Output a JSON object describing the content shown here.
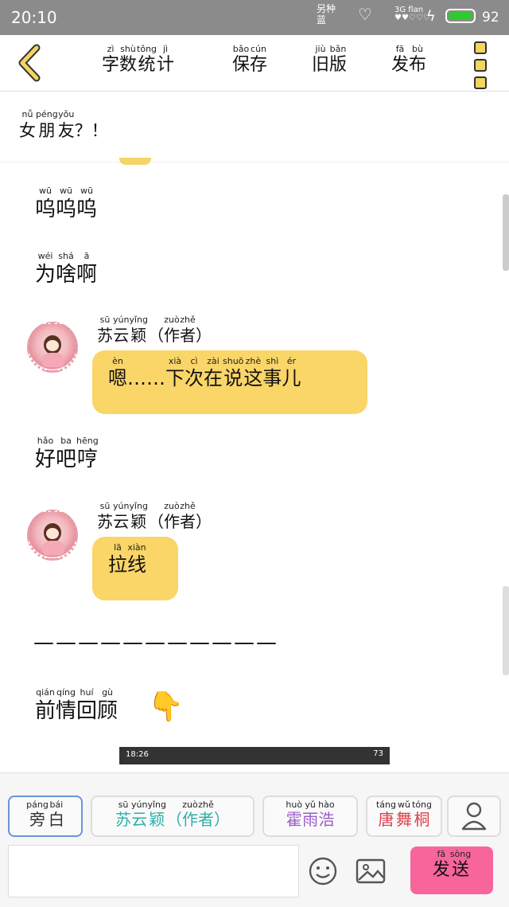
{
  "status_bar": {
    "time": "20:10",
    "carrier_top": "另种",
    "carrier_bottom": "蓝",
    "network": "3G flan",
    "signal": "♥♥♡♡♡",
    "battery_percent": "92",
    "battery_color": "#32c832"
  },
  "toolbar": {
    "items": [
      {
        "pinyin": [
          "zì",
          "shù",
          "tǒng",
          "jì"
        ],
        "hanzi": [
          "字",
          "数",
          "统",
          "计"
        ]
      },
      {
        "pinyin": [
          "bǎo",
          "cún"
        ],
        "hanzi": [
          "保",
          "存"
        ]
      },
      {
        "pinyin": [
          "jiù",
          "bǎn"
        ],
        "hanzi": [
          "旧",
          "版"
        ]
      },
      {
        "pinyin": [
          "fā",
          "bù"
        ],
        "hanzi": [
          "发",
          "布"
        ]
      }
    ]
  },
  "topic": {
    "pinyin": [
      "nǚ",
      "péng",
      "yǒu",
      ""
    ],
    "hanzi": [
      "女",
      "朋",
      "友",
      "？！"
    ]
  },
  "lines": [
    {
      "pinyin": [
        "wū",
        "wū",
        "wū"
      ],
      "hanzi": [
        "呜",
        "呜",
        "呜"
      ]
    },
    {
      "pinyin": [
        "wéi",
        "shá",
        "ā"
      ],
      "hanzi": [
        "为",
        "啥",
        "啊"
      ]
    }
  ],
  "messages": [
    {
      "sender_pinyin": [
        "sū",
        "yún",
        "yǐng",
        "",
        "zuò",
        "zhě",
        ""
      ],
      "sender_hanzi": [
        "苏",
        "云",
        "颖",
        "（",
        "作",
        "者",
        "）"
      ],
      "text_pinyin": [
        "èn",
        "",
        "xià",
        "cì",
        "zài",
        "shuō",
        "zhè",
        "shì",
        "ér"
      ],
      "text_hanzi": [
        "嗯",
        "……",
        "下",
        "次",
        "在",
        "说",
        "这",
        "事",
        "儿"
      ]
    },
    {
      "sender_pinyin": [
        "sū",
        "yún",
        "yǐng",
        "",
        "zuò",
        "zhě",
        ""
      ],
      "sender_hanzi": [
        "苏",
        "云",
        "颖",
        "（",
        "作",
        "者",
        "）"
      ],
      "text_pinyin": [
        "lā",
        "xiàn"
      ],
      "text_hanzi": [
        "拉",
        "线"
      ]
    }
  ],
  "line_haoba": {
    "pinyin": [
      "hǎo",
      "ba",
      "hēng"
    ],
    "hanzi": [
      "好",
      "吧",
      "哼"
    ]
  },
  "dashes": "———————————",
  "recap": {
    "pinyin": [
      "qián",
      "qíng",
      "huí",
      "gù"
    ],
    "hanzi": [
      "前",
      "情",
      "回",
      "顾"
    ],
    "emoji": "👇"
  },
  "embedded_screenshot": {
    "time": "18:26",
    "battery": "73"
  },
  "roles": [
    {
      "pinyin": [
        "páng",
        "bái"
      ],
      "hanzi": [
        "旁",
        "白"
      ],
      "color": "#333333"
    },
    {
      "pinyin": [
        "sū",
        "yún",
        "yǐng",
        "",
        "zuò",
        "zhě",
        ""
      ],
      "hanzi": [
        "苏",
        "云",
        "颖",
        "（",
        "作",
        "者",
        "）"
      ],
      "color": "#2bb0a8"
    },
    {
      "pinyin": [
        "huò",
        "yǔ",
        "hào"
      ],
      "hanzi": [
        "霍",
        "雨",
        "浩"
      ],
      "color": "#9b5cc8"
    },
    {
      "pinyin": [
        "táng",
        "wǔ",
        "tóng"
      ],
      "hanzi": [
        "唐",
        "舞",
        "桐"
      ],
      "color": "#e0404a"
    }
  ],
  "send": {
    "pinyin": [
      "fā",
      "sòng"
    ],
    "hanzi": [
      "发",
      "送"
    ]
  },
  "icons": {
    "back": "back-arrow-icon",
    "menu": "menu-dots-icon",
    "user": "user-icon",
    "emoji": "smiley-icon",
    "image": "image-icon"
  },
  "colors": {
    "accent_yellow": "#fad568",
    "send_pink": "#f7659b",
    "status_gray": "#8b8b8b",
    "selected_border": "#6a94d8"
  }
}
